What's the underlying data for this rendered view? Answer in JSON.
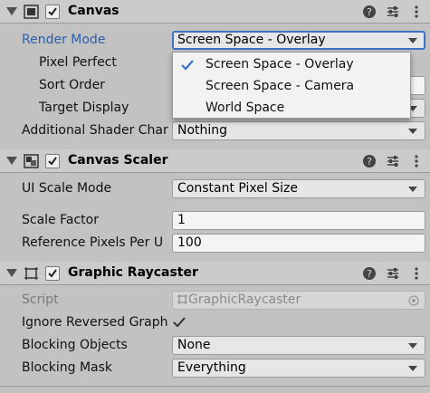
{
  "canvas": {
    "title": "Canvas",
    "render_mode": {
      "label": "Render Mode",
      "value": "Screen Space - Overlay"
    },
    "pixel_perfect": {
      "label": "Pixel Perfect"
    },
    "sort_order": {
      "label": "Sort Order"
    },
    "target_display": {
      "label": "Target Display"
    },
    "additional_shader": {
      "label": "Additional Shader Char",
      "value": "Nothing"
    },
    "render_mode_options": [
      "Screen Space - Overlay",
      "Screen Space - Camera",
      "World Space"
    ]
  },
  "canvas_scaler": {
    "title": "Canvas Scaler",
    "ui_scale_mode": {
      "label": "UI Scale Mode",
      "value": "Constant Pixel Size"
    },
    "scale_factor": {
      "label": "Scale Factor",
      "value": "1"
    },
    "reference_pixels": {
      "label": "Reference Pixels Per U",
      "value": "100"
    }
  },
  "graphic_raycaster": {
    "title": "Graphic Raycaster",
    "script": {
      "label": "Script",
      "value": "GraphicRaycaster"
    },
    "ignore_reversed": {
      "label": "Ignore Reversed Graph",
      "checked": true
    },
    "blocking_objects": {
      "label": "Blocking Objects",
      "value": "None"
    },
    "blocking_mask": {
      "label": "Blocking Mask",
      "value": "Everything"
    }
  },
  "colors": {
    "panel_bg": "#c2c2c2",
    "header_bg": "#cbcbcb",
    "accent": "#3a72c8",
    "label_blue": "#2e5fa8"
  }
}
